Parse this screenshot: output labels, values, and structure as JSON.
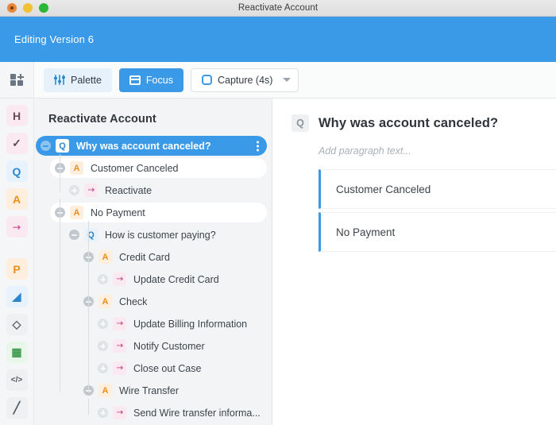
{
  "window": {
    "title": "Reactivate Account",
    "buttons": {
      "close": "close",
      "minimize": "minimize",
      "maximize": "maximize"
    }
  },
  "header": {
    "editing_label": "Editing Version 6",
    "accent": "#3b9ae8"
  },
  "toolbar": {
    "apps_icon": "grid-add-icon",
    "palette_label": "Palette",
    "focus_label": "Focus",
    "capture_label": "Capture (4s)"
  },
  "rail": {
    "items": [
      {
        "glyph": "H",
        "name": "header",
        "bg": "#fbe9f2",
        "fg": "#6b4a57"
      },
      {
        "glyph": "✓",
        "name": "checklist",
        "bg": "#fbe9f2",
        "fg": "#5f4a53"
      },
      {
        "glyph": "Q",
        "name": "question",
        "bg": "#e8f2fc",
        "fg": "#2b86cc"
      },
      {
        "glyph": "A",
        "name": "answer",
        "bg": "#fdeedd",
        "fg": "#e8901f"
      },
      {
        "glyph": "⇢",
        "name": "action",
        "bg": "#fbe9f2",
        "fg": "#d05e96"
      },
      {
        "glyph": "P",
        "name": "paragraph",
        "bg": "#fdeedd",
        "fg": "#e8901f"
      },
      {
        "glyph": "◢",
        "name": "image",
        "bg": "#e8f2fc",
        "fg": "#2b86cc"
      },
      {
        "glyph": "◇",
        "name": "decision",
        "bg": "#eef0f1",
        "fg": "#5c646b"
      },
      {
        "glyph": "▦",
        "name": "table",
        "bg": "#e9f6ea",
        "fg": "#3f9a4e"
      },
      {
        "glyph": "</>",
        "name": "code",
        "bg": "#eef0f1",
        "fg": "#4e565d"
      },
      {
        "glyph": "╱",
        "name": "pen",
        "bg": "#eef0f1",
        "fg": "#4e565d"
      }
    ]
  },
  "tree": {
    "title": "Reactivate Account",
    "nodes": [
      {
        "label": "Why was account canceled?",
        "type": "q",
        "depth": 0,
        "state": "selected",
        "toggle": "collapse",
        "menu": true
      },
      {
        "label": "Customer Canceled",
        "type": "a",
        "depth": 1,
        "state": "white",
        "toggle": "collapse"
      },
      {
        "label": "Reactivate",
        "type": "act",
        "depth": 2,
        "state": "plain",
        "toggle": "leaf"
      },
      {
        "label": "No Payment",
        "type": "a",
        "depth": 1,
        "state": "white",
        "toggle": "collapse"
      },
      {
        "label": "How is customer paying?",
        "type": "q",
        "depth": 2,
        "state": "plain",
        "toggle": "collapse"
      },
      {
        "label": "Credit Card",
        "type": "a",
        "depth": 3,
        "state": "plain",
        "toggle": "collapse"
      },
      {
        "label": "Update Credit Card",
        "type": "act",
        "depth": 4,
        "state": "plain",
        "toggle": "leaf"
      },
      {
        "label": "Check",
        "type": "a",
        "depth": 3,
        "state": "plain",
        "toggle": "collapse"
      },
      {
        "label": "Update Billing Information",
        "type": "act",
        "depth": 4,
        "state": "plain",
        "toggle": "leaf"
      },
      {
        "label": "Notify Customer",
        "type": "act",
        "depth": 4,
        "state": "plain",
        "toggle": "leaf"
      },
      {
        "label": "Close out Case",
        "type": "act",
        "depth": 4,
        "state": "plain",
        "toggle": "leaf"
      },
      {
        "label": "Wire Transfer",
        "type": "a",
        "depth": 3,
        "state": "plain",
        "toggle": "collapse"
      },
      {
        "label": "Send Wire transfer informa...",
        "type": "act",
        "depth": 4,
        "state": "plain",
        "toggle": "leaf"
      }
    ]
  },
  "detail": {
    "icon_glyph": "Q",
    "title": "Why was account canceled?",
    "paragraph_placeholder": "Add paragraph text...",
    "answers": [
      {
        "label": "Customer Canceled"
      },
      {
        "label": "No Payment"
      }
    ]
  }
}
